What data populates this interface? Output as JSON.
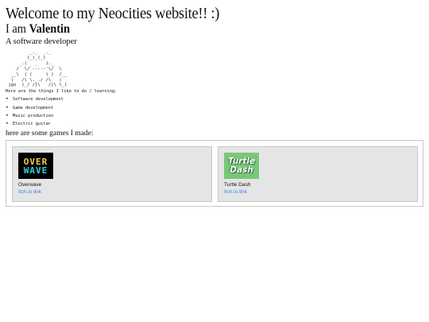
{
  "header": {
    "title": "Welcome to my Neocities website!! :)",
    "intro_prefix": "I am",
    "name": "Valentin",
    "tagline": "A software developer"
  },
  "ascii_art": "         _._  _._\n        (_)_(_)\n     _.(   _   )._\n    /  \\/`-----'\\/  \\\n  __\\  ( (     ) )  /__\n  )   /\\ \\._./ /\\   (\n jgs  )_/ /|\\   /|\\ \\_(",
  "interests": {
    "title": "Here are the things I like to do / learning:",
    "items": [
      "Software development",
      "Game development",
      "Music production",
      "Electric guitar"
    ],
    "bullet": "•"
  },
  "games": {
    "title": "here are some games I made:",
    "items": [
      {
        "name": "Overwave",
        "link_label": "Itch.io link",
        "thumb_lines": [
          "OVER",
          "WAVE"
        ]
      },
      {
        "name": "Turtle Dash",
        "link_label": "Itch.io link",
        "thumb_lines": [
          "Turtle",
          "Dash"
        ]
      }
    ]
  },
  "colors": {
    "link": "#3b82f6",
    "card_bg": "#e5e5e5",
    "overwave_top": "#f2c94c",
    "overwave_bottom": "#29d3e0",
    "turtle_bg": "#79c77a"
  }
}
